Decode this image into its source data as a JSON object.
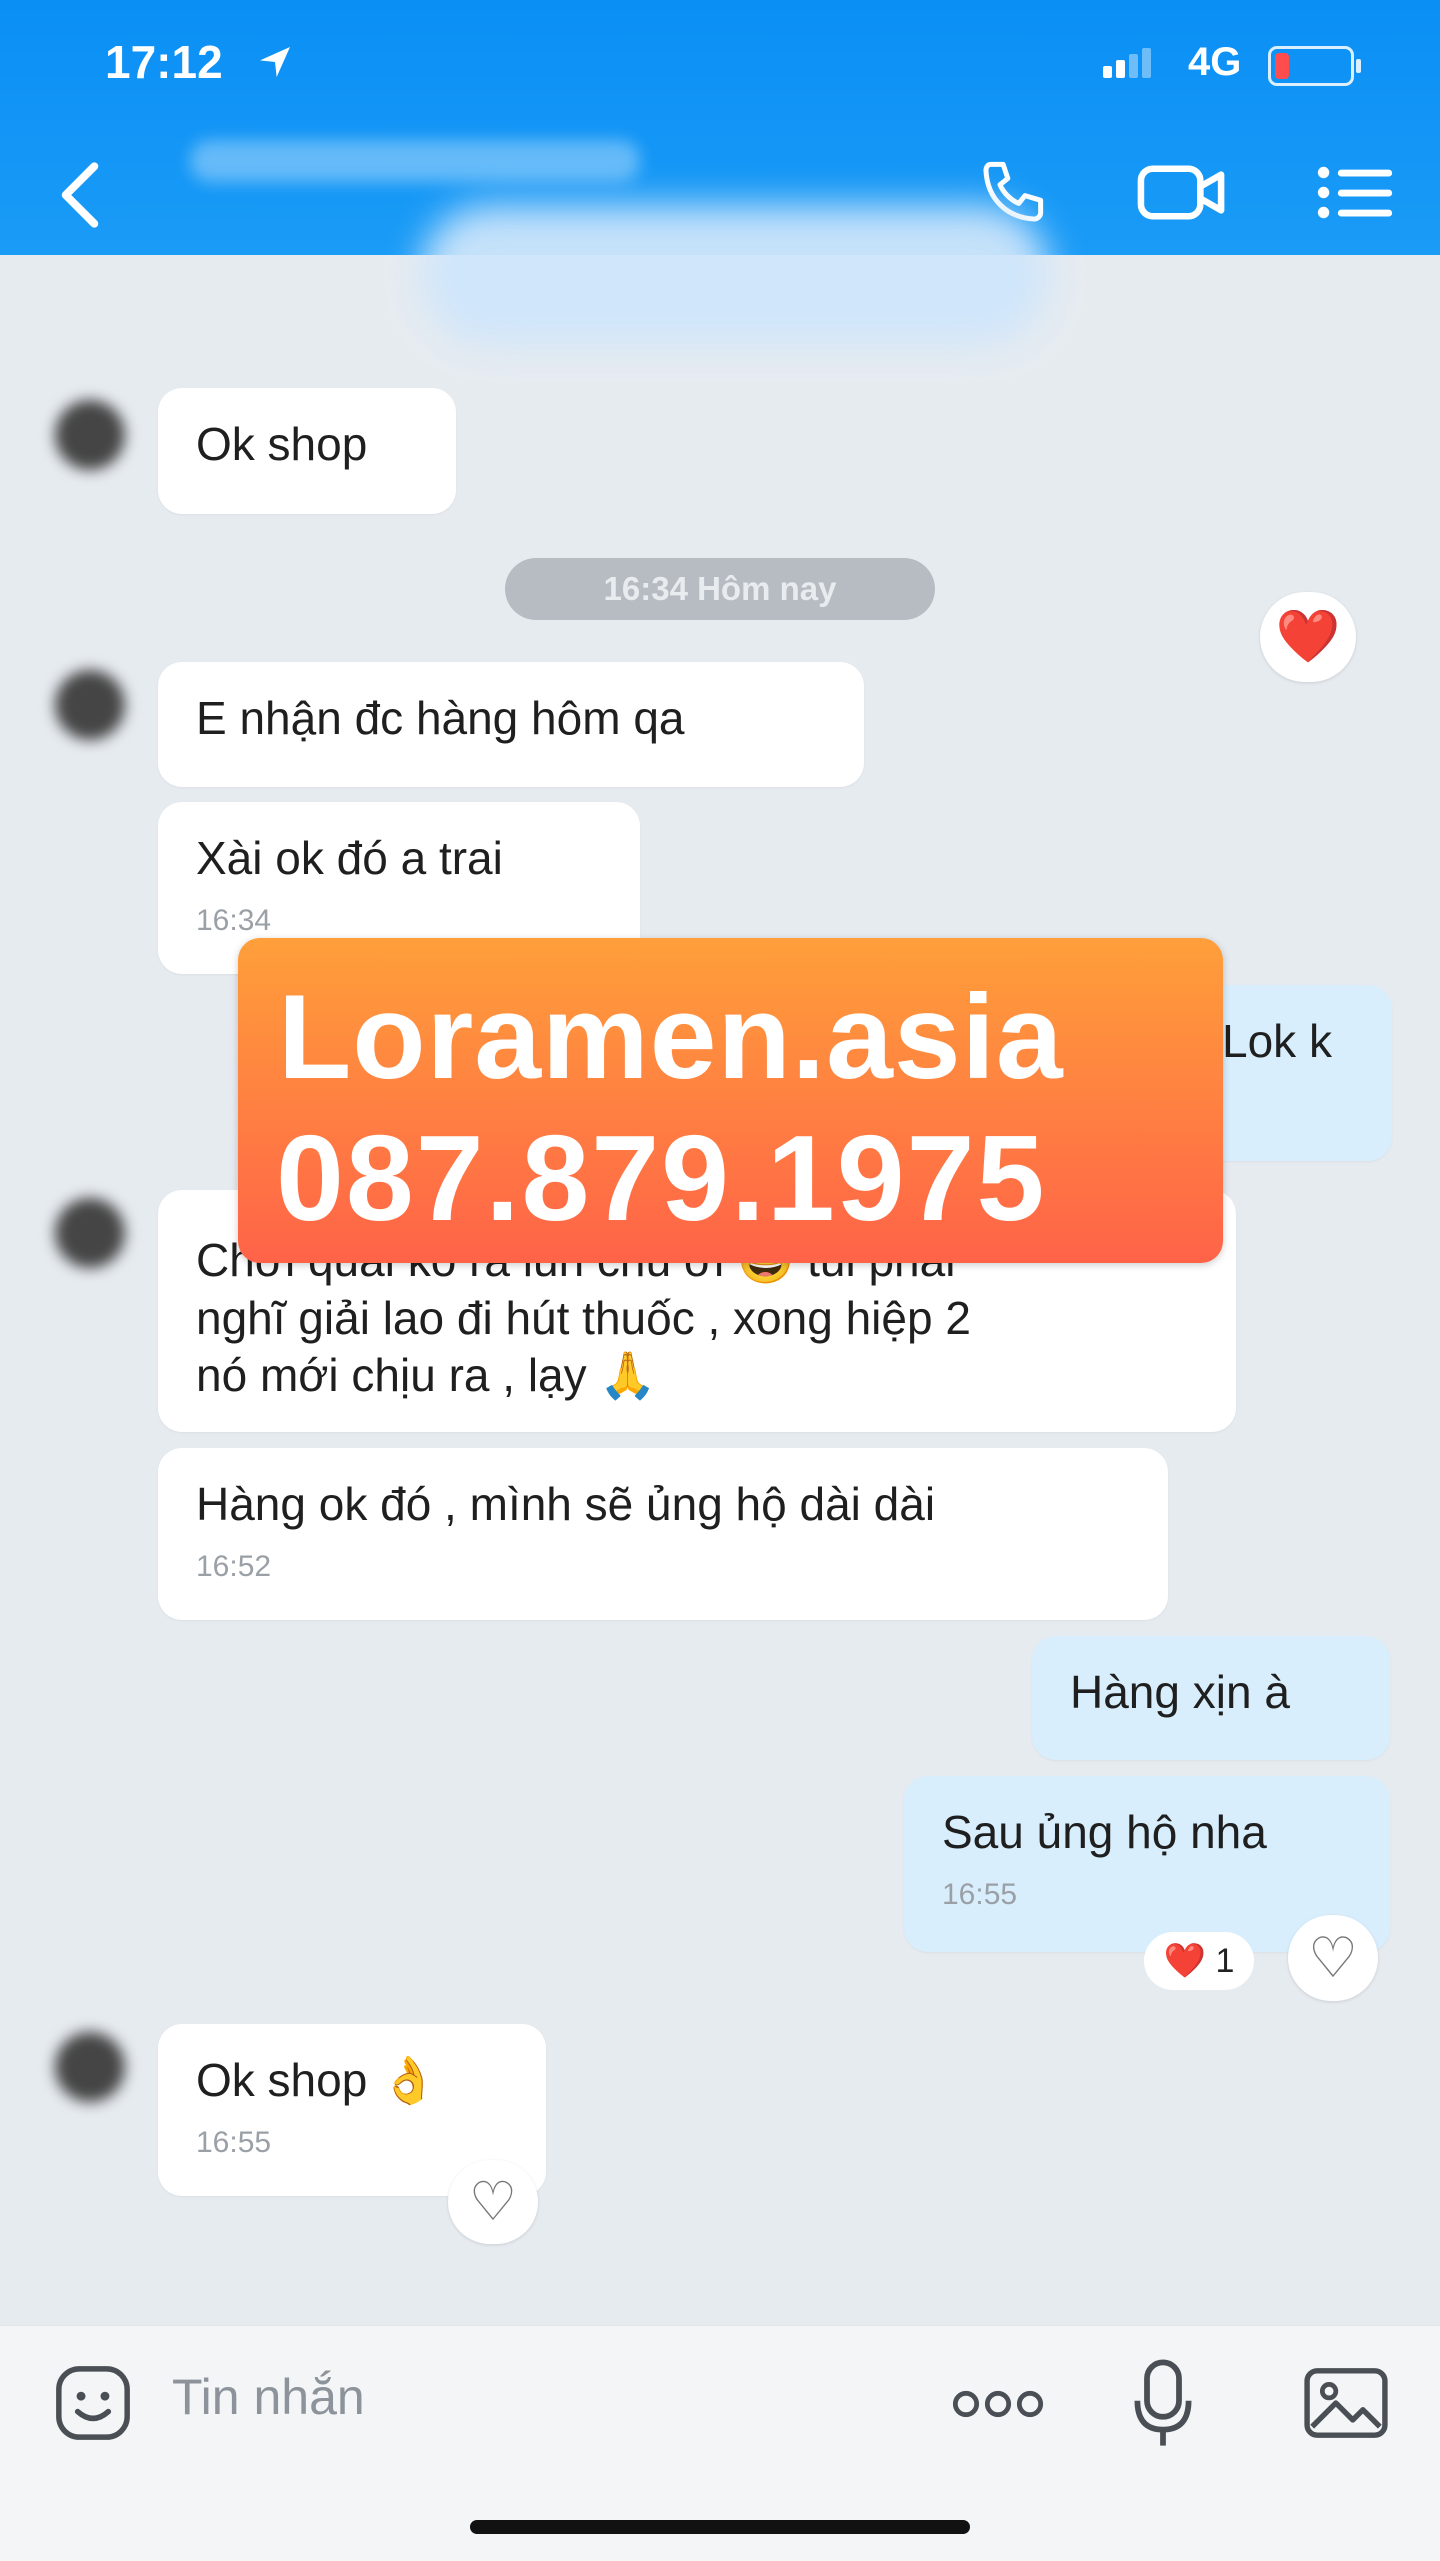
{
  "status_bar": {
    "time": "17:12",
    "network": "4G",
    "icons": [
      "location-arrow-icon",
      "signal-icon",
      "battery-icon"
    ]
  },
  "header": {
    "icons": [
      "back-icon",
      "phone-icon",
      "video-call-icon",
      "menu-list-icon"
    ]
  },
  "colors": {
    "header": "#1a9bf6",
    "sent_bubble": "#d8eefd",
    "received_bubble": "#ffffff",
    "watermark": "#ff7a3f"
  },
  "timestamp_divider": "16:34 Hôm nay",
  "messages": [
    {
      "from": "contact",
      "text": "Ok shop"
    },
    {
      "from": "contact",
      "text": "E nhận đc hàng hôm qa"
    },
    {
      "from": "contact",
      "text": "Xài ok đó a trai",
      "time": "16:34"
    },
    {
      "from": "me",
      "text": "Lok k"
    },
    {
      "from": "contact",
      "text_lines": [
        "Chơi quải ko ra lun chú ơi 😆 tui phải",
        "nghĩ giải lao đi hút thuốc , xong hiệp 2",
        "nó mới chịu ra , lạy 🙏"
      ]
    },
    {
      "from": "contact",
      "text": "Hàng ok đó , mình sẽ ủng hộ dài dài",
      "time": "16:52"
    },
    {
      "from": "me",
      "text": "Hàng xịn à"
    },
    {
      "from": "me",
      "text": "Sau ủng hộ nha",
      "time": "16:55",
      "reaction": "❤️",
      "reaction_count": "1"
    },
    {
      "from": "contact",
      "text": "Ok shop 👌",
      "time": "16:55"
    }
  ],
  "reactions": {
    "heart": "❤️",
    "empty_heart": "♡"
  },
  "watermark": {
    "line1": "Loramen.asia",
    "line2": "087.879.1975"
  },
  "input": {
    "placeholder": "Tin nhắn"
  },
  "bottom_icons": [
    "sticker-icon",
    "more-icon",
    "microphone-icon",
    "image-icon"
  ]
}
